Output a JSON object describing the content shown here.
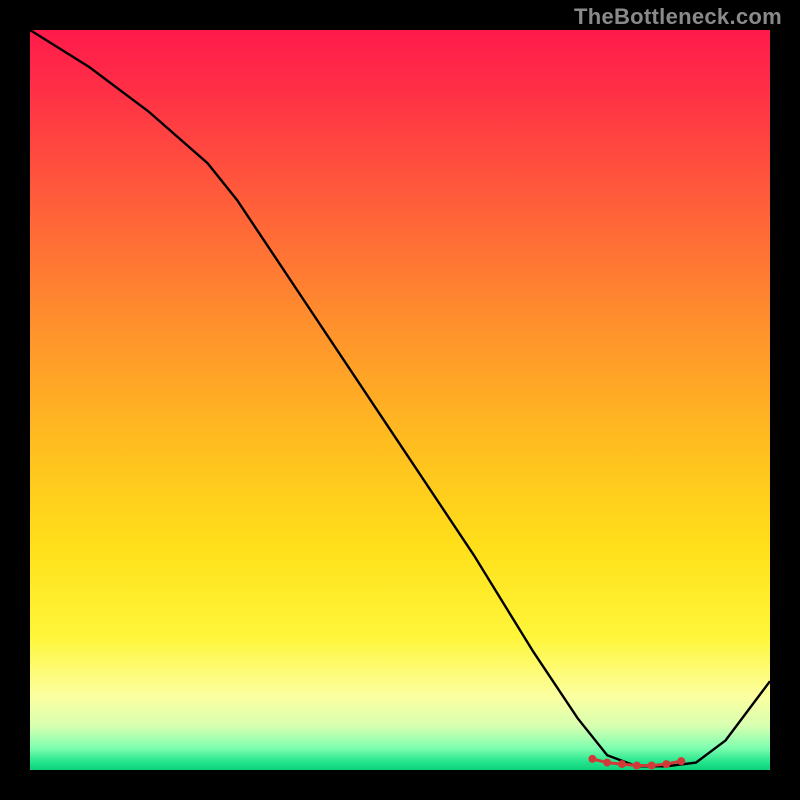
{
  "watermark": "TheBottleneck.com",
  "colors": {
    "curve": "#000000",
    "marker": "#d23a3a",
    "frame_bg": "#000000"
  },
  "chart_data": {
    "type": "line",
    "title": "",
    "xlabel": "",
    "ylabel": "",
    "xlim": [
      0,
      100
    ],
    "ylim": [
      0,
      100
    ],
    "grid": false,
    "legend": false,
    "description": "Bottleneck-style curve over a vertical heat gradient. X is an unlabeled parameter (left→right), Y is an unlabeled percentage (top=100, bottom=0). The curve starts at ~100 at x=0, stays high until about x≈25, then falls nearly linearly to ~0 around x≈78–88, then rises again toward the right edge. A cluster of small red markers sits along the valley floor.",
    "series": [
      {
        "name": "curve",
        "x": [
          0,
          8,
          16,
          24,
          28,
          36,
          44,
          52,
          60,
          68,
          74,
          78,
          82,
          86,
          90,
          94,
          100
        ],
        "y": [
          100,
          95,
          89,
          82,
          77,
          65,
          53,
          41,
          29,
          16,
          7,
          2,
          0.5,
          0.5,
          1,
          4,
          12
        ]
      }
    ],
    "markers": {
      "name": "valley",
      "x": [
        76,
        78,
        80,
        82,
        84,
        86,
        88
      ],
      "y": [
        1.5,
        1.0,
        0.8,
        0.6,
        0.6,
        0.8,
        1.2
      ]
    }
  }
}
